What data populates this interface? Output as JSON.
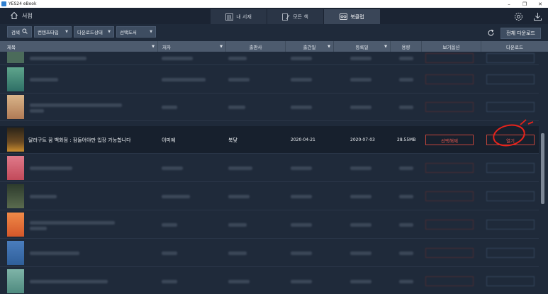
{
  "window": {
    "title": "YES24 eBook",
    "controls": [
      "–",
      "❐",
      "✕"
    ]
  },
  "header": {
    "home_label": "서점",
    "tabs": [
      {
        "label": "내 서재",
        "icon": "bookshelf-icon",
        "active": false
      },
      {
        "label": "모든 책",
        "icon": "book-pen-icon",
        "active": false
      },
      {
        "label": "북클럽",
        "icon": "bookclub-icon",
        "active": true
      }
    ]
  },
  "toolbar": {
    "search_label": "검색",
    "selects": [
      "컨텐츠타입",
      "다운로드상태",
      "선택도서"
    ],
    "download_all_label": "전체 다운로드"
  },
  "table": {
    "columns": [
      "제목",
      "저자",
      "출판사",
      "출간일",
      "등록일",
      "용량",
      "보기옵션",
      "다운로드"
    ],
    "active_row": {
      "title": "달러구트 꿈 백화점 : 잠들어야만 입장 가능합니다",
      "author": "이미예",
      "publisher": "북닻",
      "pub_date": "2020-04-21",
      "reg_date": "2020-07-03",
      "size": "28.55MB",
      "view_option_label": "선택해제",
      "download_label": "열기"
    }
  },
  "colors": {
    "accent_red": "#e6594f",
    "header_bg": "#4d5b6e",
    "app_bg": "#1f2a3a",
    "annotation_red": "#e8231b"
  }
}
